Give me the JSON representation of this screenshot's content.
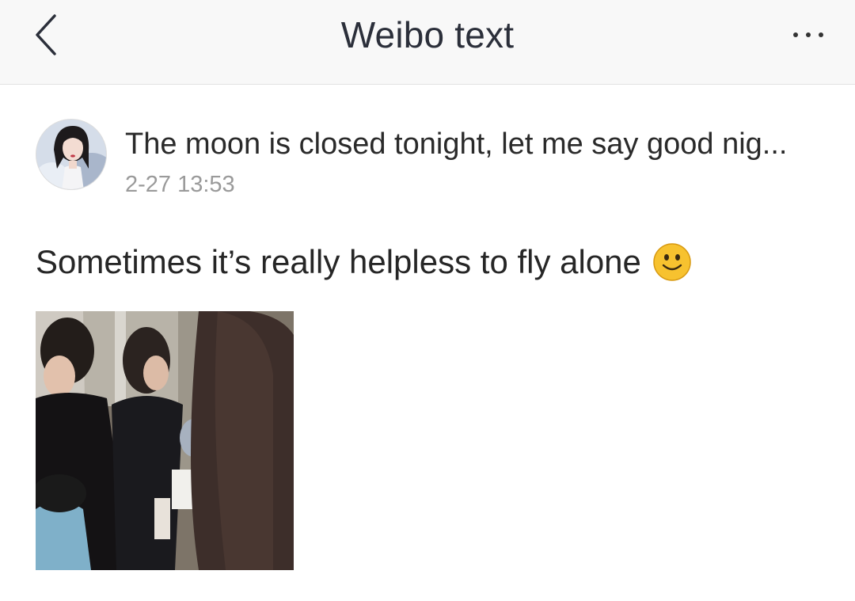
{
  "header": {
    "title": "Weibo text",
    "back_icon": "chevron-left-icon",
    "more_icon": "more-horizontal-icon"
  },
  "post": {
    "author_line": "The moon is closed tonight, let me say good nig...",
    "timestamp": "2-27 13:53",
    "text": "Sometimes it’s really helpless to fly alone",
    "emoji": "smile-emoji-icon",
    "photo": "photo-of-people-in-crowd"
  },
  "colors": {
    "header_bg": "#f8f8f8",
    "title": "#2b2f3a",
    "timestamp": "#9a9a9a",
    "emoji": "#f7c22f"
  }
}
